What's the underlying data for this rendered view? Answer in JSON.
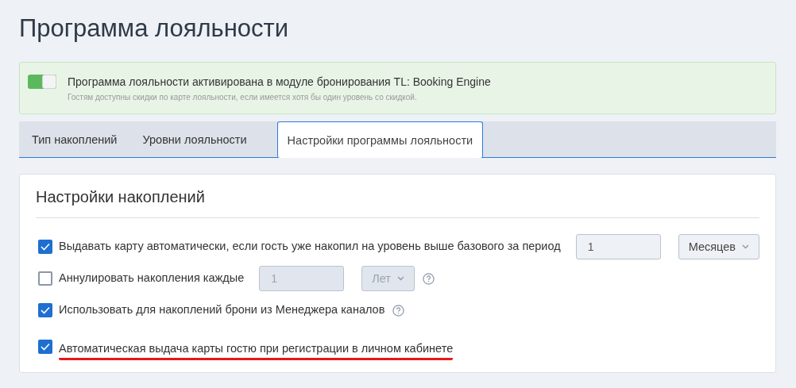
{
  "page_title": "Программа лояльности",
  "banner": {
    "toggle_on": true,
    "title": "Программа лояльности активирована в модуле бронирования TL: Booking Engine",
    "note": "Гостям доступны скидки по карте лояльности, если имеется хотя бы один уровень со скидкой."
  },
  "tabs": [
    {
      "label": "Тип накоплений",
      "selected": false
    },
    {
      "label": "Уровни лояльности",
      "selected": false
    },
    {
      "label": "Настройки программы лояльности",
      "selected": true
    }
  ],
  "section": {
    "title": "Настройки накоплений",
    "options": [
      {
        "label": "Выдавать карту автоматически, если гость уже накопил на уровень выше базового за период",
        "checked": true,
        "value": "1",
        "unit": "Месяцев",
        "disabled": false,
        "underlined": false
      },
      {
        "label": "Аннулировать накопления каждые",
        "checked": false,
        "value": "1",
        "unit": "Лет",
        "disabled": true,
        "help": true,
        "underlined": false
      },
      {
        "label": "Использовать для накоплений брони из Менеджера каналов",
        "checked": true,
        "help": true,
        "underlined": false
      },
      {
        "label": "Автоматическая выдача карты гостю при регистрации в личном кабинете",
        "checked": true,
        "underlined": true
      }
    ]
  }
}
